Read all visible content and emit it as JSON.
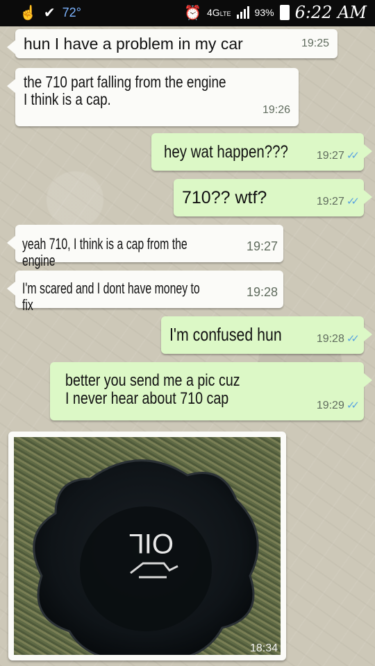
{
  "status_bar": {
    "temperature": "72°",
    "network": "4G",
    "network_sub": "LTE",
    "battery": "93%",
    "time": "6:22 AM"
  },
  "messages": [
    {
      "dir": "in",
      "text": "hun I have a problem in my car",
      "time": "19:25"
    },
    {
      "dir": "in",
      "text": "the 710 part falling from the engine\nI think is a cap.",
      "time": "19:26"
    },
    {
      "dir": "out",
      "text": "hey wat happen???",
      "time": "19:27"
    },
    {
      "dir": "out",
      "text": "710?? wtf?",
      "time": "19:27"
    },
    {
      "dir": "in",
      "text": "yeah 710, I think is a cap from the engine",
      "time": "19:27"
    },
    {
      "dir": "in",
      "text": "I'm scared and I dont have money to fix",
      "time": "19:28"
    },
    {
      "dir": "out",
      "text": "I'm confused hun",
      "time": "19:28"
    },
    {
      "dir": "out",
      "text": "better you send me a pic cuz\nI never hear about 710 cap",
      "time": "19:29"
    }
  ],
  "photo_message": {
    "cap_label": "OIL",
    "time": "18:34"
  },
  "read_ticks": "✓✓",
  "colors": {
    "incoming": "#fbfbf8",
    "outgoing": "#dcf8c6",
    "ticks": "#5ba4e0"
  }
}
